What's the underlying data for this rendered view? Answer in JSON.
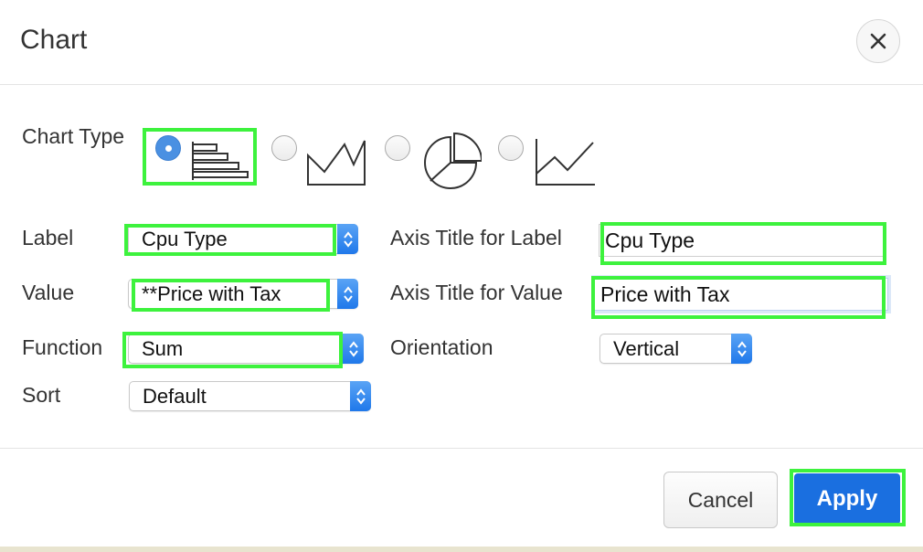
{
  "dialog": {
    "title": "Chart",
    "close_icon": "close-icon"
  },
  "chart_type": {
    "label": "Chart Type",
    "options": [
      {
        "icon": "horizontal-bar-chart-icon",
        "selected": true
      },
      {
        "icon": "area-chart-icon",
        "selected": false
      },
      {
        "icon": "pie-chart-icon",
        "selected": false
      },
      {
        "icon": "line-chart-icon",
        "selected": false
      }
    ]
  },
  "fields": {
    "label": {
      "label": "Label",
      "value": "Cpu Type"
    },
    "value": {
      "label": "Value",
      "value": "**Price with Tax"
    },
    "function": {
      "label": "Function",
      "value": "Sum"
    },
    "sort": {
      "label": "Sort",
      "value": "Default"
    },
    "axis_title_label": {
      "label": "Axis Title for Label",
      "value": "Cpu Type"
    },
    "axis_title_value": {
      "label": "Axis Title for Value",
      "value": "Price with Tax"
    },
    "orientation": {
      "label": "Orientation",
      "value": "Vertical"
    }
  },
  "footer": {
    "cancel_label": "Cancel",
    "apply_label": "Apply"
  },
  "colors": {
    "accent": "#1a6fe0",
    "highlight": "#3df23d",
    "radio_selected": "#4a90e2"
  }
}
